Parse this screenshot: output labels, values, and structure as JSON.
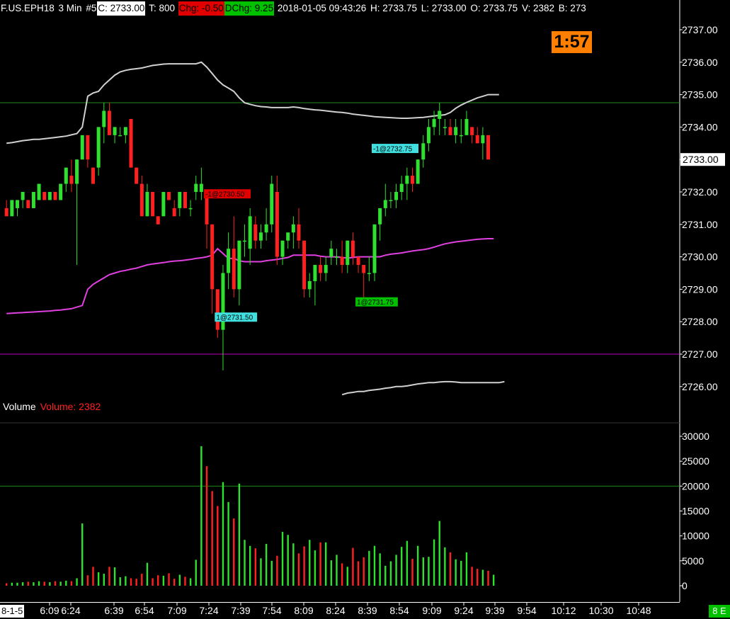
{
  "header": {
    "symbol": "F.US.EPH18",
    "interval": "3 Min",
    "chart_num": "#5",
    "close": "C: 2733.00",
    "ticks": "T: 800",
    "chg": "Chg: -0.50",
    "dchg": "DChg: 9.25",
    "datetime": "2018-01-05 09:43:26",
    "high": "H: 2733.75",
    "low": "L: 2733.00",
    "open": "O: 2733.75",
    "volume": "V: 2382",
    "bid": "B: 273"
  },
  "timer": "1:57",
  "volume_panel": {
    "label": "Volume",
    "value_label": "Volume: 2382"
  },
  "footer": {
    "left_label": "8-1-5",
    "right_label": "8 E"
  },
  "colors": {
    "up": "#30e030",
    "down": "#ff2020",
    "band": "#d0d0d0",
    "vwap": "#e040e0",
    "hline_green": "#1a8a1a",
    "hline_magenta": "#c000c0",
    "order_cyan": "#40e0e0"
  },
  "chart_data": {
    "type": "candlestick",
    "price_axis": {
      "ticks": [
        "2737.00",
        "2736.00",
        "2735.00",
        "2734.00",
        "2733.00",
        "2732.00",
        "2731.00",
        "2730.00",
        "2729.00",
        "2728.00",
        "2727.00",
        "2726.00"
      ],
      "current": "2733.00",
      "range": [
        2725.75,
        2737.15
      ]
    },
    "volume_axis": {
      "ticks": [
        "30000",
        "25000",
        "20000",
        "15000",
        "10000",
        "5000",
        "0"
      ],
      "range": [
        0,
        32000
      ]
    },
    "time_ticks": [
      "6:09",
      "6:24",
      "6:39",
      "6:54",
      "7:09",
      "7:24",
      "7:39",
      "7:54",
      "8:09",
      "8:24",
      "8:39",
      "8:54",
      "9:09",
      "9:24",
      "9:39",
      "9:54",
      "10:12",
      "10:30",
      "10:48"
    ],
    "candles": [
      [
        2731.5,
        2731.75,
        2731.25,
        2731.25
      ],
      [
        2731.25,
        2731.75,
        2731.25,
        2731.75
      ],
      [
        2731.5,
        2731.75,
        2731.25,
        2731.75
      ],
      [
        2731.75,
        2732.0,
        2731.5,
        2732.0
      ],
      [
        2731.75,
        2731.75,
        2731.5,
        2731.5
      ],
      [
        2731.5,
        2732.0,
        2731.5,
        2732.0
      ],
      [
        2731.75,
        2732.25,
        2731.75,
        2732.25
      ],
      [
        2732.0,
        2732.0,
        2731.75,
        2731.75
      ],
      [
        2731.75,
        2732.0,
        2731.75,
        2732.0
      ],
      [
        2732.0,
        2732.0,
        2731.75,
        2731.75
      ],
      [
        2731.75,
        2732.25,
        2731.75,
        2732.25
      ],
      [
        2732.25,
        2732.75,
        2732.0,
        2732.75
      ],
      [
        2732.5,
        2733.0,
        2732.0,
        2732.25
      ],
      [
        2732.25,
        2733.0,
        2729.75,
        2733.0
      ],
      [
        2733.0,
        2733.75,
        2733.0,
        2733.75
      ],
      [
        2733.75,
        2733.75,
        2732.75,
        2733.0
      ],
      [
        2732.75,
        2732.75,
        2732.25,
        2732.25
      ],
      [
        2732.75,
        2734.0,
        2732.5,
        2734.0
      ],
      [
        2734.0,
        2734.75,
        2733.5,
        2734.5
      ],
      [
        2734.5,
        2734.75,
        2733.75,
        2733.75
      ],
      [
        2733.75,
        2734.0,
        2733.5,
        2734.0
      ],
      [
        2733.75,
        2734.0,
        2733.75,
        2733.75
      ],
      [
        2733.75,
        2734.0,
        2733.5,
        2734.0
      ],
      [
        2734.25,
        2734.25,
        2732.75,
        2732.75
      ],
      [
        2732.75,
        2732.75,
        2732.25,
        2732.25
      ],
      [
        2732.25,
        2732.5,
        2731.25,
        2731.25
      ],
      [
        2731.25,
        2732.25,
        2731.25,
        2732.0
      ],
      [
        2732.0,
        2732.0,
        2731.25,
        2731.25
      ],
      [
        2731.25,
        2731.25,
        2731.0,
        2731.0
      ],
      [
        2731.25,
        2732.0,
        2731.25,
        2732.0
      ],
      [
        2732.0,
        2732.0,
        2731.75,
        2731.75
      ],
      [
        2731.5,
        2731.75,
        2731.25,
        2731.25
      ],
      [
        2731.5,
        2732.0,
        2731.25,
        2732.0
      ],
      [
        2732.0,
        2732.0,
        2731.5,
        2731.5
      ],
      [
        2731.5,
        2731.75,
        2731.25,
        2731.5
      ],
      [
        2732.0,
        2732.5,
        2731.75,
        2732.25
      ],
      [
        2732.0,
        2732.75,
        2731.75,
        2732.25
      ],
      [
        2732.0,
        2732.0,
        2730.25,
        2731.0
      ],
      [
        2731.0,
        2731.0,
        2728.25,
        2729.0
      ],
      [
        2729.0,
        2729.0,
        2727.5,
        2727.75
      ],
      [
        2727.75,
        2729.75,
        2726.5,
        2729.5
      ],
      [
        2729.5,
        2730.75,
        2729.0,
        2730.25
      ],
      [
        2730.25,
        2731.25,
        2728.75,
        2729.0
      ],
      [
        2729.0,
        2730.5,
        2728.5,
        2730.5
      ],
      [
        2730.5,
        2731.0,
        2730.0,
        2730.5
      ],
      [
        2730.25,
        2731.5,
        2729.75,
        2731.25
      ],
      [
        2731.0,
        2731.25,
        2730.25,
        2730.5
      ],
      [
        2730.5,
        2731.0,
        2730.25,
        2730.75
      ],
      [
        2730.75,
        2731.5,
        2730.5,
        2731.0
      ],
      [
        2731.0,
        2732.5,
        2730.75,
        2732.25
      ],
      [
        2732.0,
        2732.5,
        2729.75,
        2730.0
      ],
      [
        2730.0,
        2730.5,
        2729.75,
        2730.5
      ],
      [
        2730.5,
        2730.75,
        2730.25,
        2730.75
      ],
      [
        2730.75,
        2731.25,
        2730.25,
        2731.0
      ],
      [
        2731.0,
        2731.5,
        2730.25,
        2730.5
      ],
      [
        2730.5,
        2730.5,
        2728.75,
        2729.0
      ],
      [
        2729.0,
        2729.5,
        2728.75,
        2729.25
      ],
      [
        2729.25,
        2729.75,
        2728.5,
        2729.75
      ],
      [
        2729.75,
        2730.0,
        2729.25,
        2729.5
      ],
      [
        2729.5,
        2730.0,
        2729.25,
        2729.75
      ],
      [
        2730.0,
        2730.5,
        2729.75,
        2730.25
      ],
      [
        2730.0,
        2730.25,
        2729.75,
        2730.0
      ],
      [
        2730.0,
        2730.5,
        2729.5,
        2729.75
      ],
      [
        2729.75,
        2730.5,
        2729.5,
        2730.5
      ],
      [
        2730.5,
        2730.75,
        2729.75,
        2730.0
      ],
      [
        2730.0,
        2730.0,
        2729.5,
        2729.75
      ],
      [
        2729.75,
        2729.75,
        2728.75,
        2729.5
      ],
      [
        2729.5,
        2730.0,
        2729.25,
        2729.5
      ],
      [
        2729.5,
        2730.25,
        2729.25,
        2731.0
      ],
      [
        2731.0,
        2731.5,
        2730.5,
        2731.5
      ],
      [
        2731.5,
        2732.25,
        2731.25,
        2731.75
      ],
      [
        2731.75,
        2732.0,
        2731.5,
        2731.75
      ],
      [
        2731.75,
        2732.25,
        2731.5,
        2732.0
      ],
      [
        2732.0,
        2732.5,
        2731.75,
        2732.25
      ],
      [
        2732.25,
        2732.75,
        2731.75,
        2732.5
      ],
      [
        2732.5,
        2732.75,
        2732.0,
        2732.25
      ],
      [
        2732.25,
        2733.0,
        2732.25,
        2733.0
      ],
      [
        2733.0,
        2733.75,
        2732.75,
        2733.5
      ],
      [
        2733.5,
        2734.25,
        2733.25,
        2734.0
      ],
      [
        2734.0,
        2734.5,
        2733.75,
        2734.25
      ],
      [
        2734.25,
        2734.75,
        2733.75,
        2734.5
      ],
      [
        2734.0,
        2734.25,
        2733.75,
        2734.0
      ],
      [
        2734.0,
        2734.25,
        2733.75,
        2733.75
      ],
      [
        2733.75,
        2734.25,
        2733.5,
        2734.0
      ],
      [
        2733.75,
        2734.25,
        2733.5,
        2733.75
      ],
      [
        2733.75,
        2734.5,
        2733.75,
        2734.25
      ],
      [
        2734.0,
        2734.0,
        2733.5,
        2733.75
      ],
      [
        2733.75,
        2734.0,
        2733.5,
        2733.5
      ],
      [
        2733.5,
        2734.0,
        2733.0,
        2733.75
      ],
      [
        2733.75,
        2733.75,
        2733.0,
        2733.0
      ]
    ],
    "volumes": [
      500,
      600,
      600,
      700,
      800,
      700,
      900,
      800,
      700,
      900,
      800,
      1000,
      900,
      1500,
      12500,
      2100,
      3800,
      2700,
      2400,
      3800,
      3700,
      1700,
      1900,
      1500,
      1400,
      2400,
      4600,
      1500,
      2100,
      2000,
      2500,
      1400,
      2200,
      1800,
      1500,
      5200,
      28000,
      24000,
      19000,
      16000,
      20800,
      16800,
      13500,
      20500,
      9200,
      8000,
      7500,
      5500,
      8400,
      5000,
      6000,
      10800,
      10200,
      8500,
      6500,
      7900,
      9200,
      7100,
      8700,
      8700,
      5100,
      6200,
      4500,
      3800,
      7600,
      4900,
      5700,
      7000,
      8000,
      6500,
      4000,
      4900,
      6200,
      7800,
      9000,
      5400,
      8000,
      5700,
      5800,
      9300,
      13000,
      7700,
      6700,
      5300,
      5000,
      6700,
      3800,
      3400,
      3200,
      3000,
      2200
    ],
    "upper_band": [
      2733.5,
      2733.52,
      2733.55,
      2733.58,
      2733.6,
      2733.62,
      2733.62,
      2733.64,
      2733.66,
      2733.68,
      2733.7,
      2733.72,
      2733.76,
      2733.8,
      2734.0,
      2734.95,
      2735.05,
      2735.1,
      2735.3,
      2735.45,
      2735.6,
      2735.7,
      2735.75,
      2735.78,
      2735.8,
      2735.82,
      2735.86,
      2735.9,
      2735.92,
      2735.94,
      2735.95,
      2735.95,
      2735.95,
      2735.95,
      2735.95,
      2735.95,
      2736.0,
      2735.85,
      2735.65,
      2735.45,
      2735.3,
      2735.2,
      2735.1,
      2734.9,
      2734.75,
      2734.7,
      2734.66,
      2734.63,
      2734.62,
      2734.6,
      2734.6,
      2734.6,
      2734.6,
      2734.62,
      2734.6,
      2734.57,
      2734.55,
      2734.53,
      2734.52,
      2734.5,
      2734.48,
      2734.46,
      2734.45,
      2734.43,
      2734.4,
      2734.38,
      2734.36,
      2734.34,
      2734.32,
      2734.31,
      2734.3,
      2734.29,
      2734.28,
      2734.27,
      2734.27,
      2734.28,
      2734.29,
      2734.3,
      2734.32,
      2734.34,
      2734.36,
      2734.38,
      2734.45,
      2734.58,
      2734.68,
      2734.76,
      2734.83,
      2734.9,
      2734.95,
      2735.0,
      2735.0,
      2735.0
    ],
    "vwap": [
      2728.25,
      2728.26,
      2728.27,
      2728.28,
      2728.29,
      2728.3,
      2728.31,
      2728.32,
      2728.33,
      2728.35,
      2728.36,
      2728.38,
      2728.4,
      2728.45,
      2728.5,
      2729.0,
      2729.15,
      2729.25,
      2729.35,
      2729.45,
      2729.5,
      2729.55,
      2729.58,
      2729.62,
      2729.65,
      2729.7,
      2729.75,
      2729.78,
      2729.8,
      2729.82,
      2729.85,
      2729.87,
      2729.88,
      2729.9,
      2729.92,
      2729.95,
      2729.97,
      2730.0,
      2730.05,
      2730.25,
      2730.1,
      2729.95,
      2729.95,
      2729.88,
      2729.85,
      2729.85,
      2729.85,
      2729.85,
      2729.88,
      2729.9,
      2729.92,
      2729.95,
      2729.98,
      2730.05,
      2730.05,
      2730.05,
      2730.05,
      2730.05,
      2730.02,
      2730.0,
      2730.0,
      2730.0,
      2729.98,
      2729.96,
      2729.98,
      2730.0,
      2730.0,
      2730.0,
      2730.0,
      2730.0,
      2730.05,
      2730.08,
      2730.1,
      2730.12,
      2730.15,
      2730.18,
      2730.2,
      2730.22,
      2730.25,
      2730.3,
      2730.35,
      2730.4,
      2730.43,
      2730.46,
      2730.48,
      2730.5,
      2730.52,
      2730.54,
      2730.55,
      2730.56,
      2730.56
    ],
    "lower_band_start_index": 62,
    "lower_band": [
      2725.75,
      2725.8,
      2725.82,
      2725.85,
      2725.85,
      2725.88,
      2725.9,
      2725.92,
      2725.95,
      2725.97,
      2726.0,
      2726.0,
      2726.02,
      2726.05,
      2726.08,
      2726.1,
      2726.12,
      2726.12,
      2726.14,
      2726.15,
      2726.15,
      2726.14,
      2726.12,
      2726.12,
      2726.12,
      2726.12,
      2726.12,
      2726.12,
      2726.12,
      2726.12,
      2726.15
    ],
    "hlines": [
      {
        "price": 2734.75,
        "kind": "green"
      },
      {
        "price": 2727.0,
        "kind": "magenta"
      }
    ],
    "volume_hline": 20000,
    "orders": [
      {
        "label": "-1@2730.50",
        "bar": 37,
        "price": 2731.93,
        "bg": "#e00000",
        "fg": "#000"
      },
      {
        "label": "1@2731.50",
        "bar": 39,
        "price": 2728.13,
        "bg": "#40e0e0",
        "fg": "#000"
      },
      {
        "label": "-1@2732.75",
        "bar": 68,
        "price": 2733.33,
        "bg": "#40e0e0",
        "fg": "#000"
      },
      {
        "label": "1@2731.75",
        "bar": 65,
        "price": 2728.6,
        "bg": "#00c000",
        "fg": "#000"
      }
    ]
  }
}
